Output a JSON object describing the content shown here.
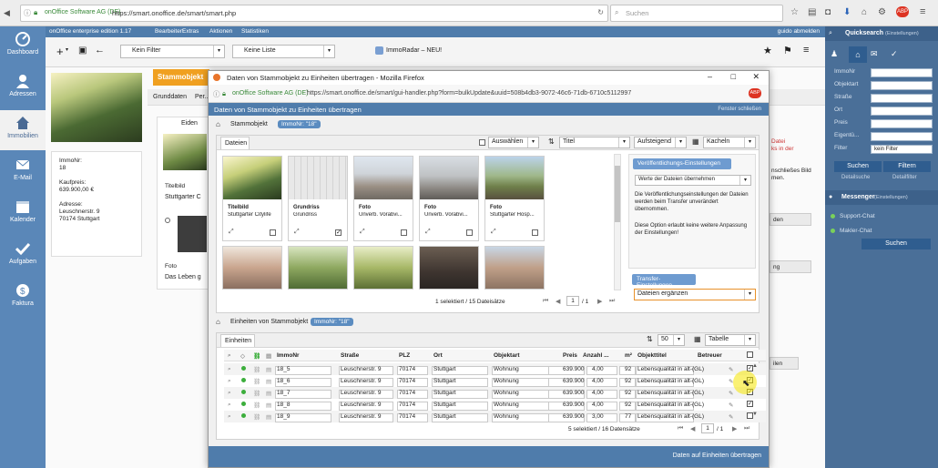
{
  "browser": {
    "url": "https://smart.onoffice.de/smart/smart.php",
    "site_identity": "onOffice Software AG (DE)",
    "search_placeholder": "Suchen"
  },
  "leftnav": [
    {
      "label": "Dashboard",
      "icon": "dashboard-icon"
    },
    {
      "label": "Adressen",
      "icon": "person-icon"
    },
    {
      "label": "Immobilien",
      "icon": "house-icon"
    },
    {
      "label": "E-Mail",
      "icon": "envelope-icon"
    },
    {
      "label": "Kalender",
      "icon": "calendar-icon"
    },
    {
      "label": "Aufgaben",
      "icon": "check-icon"
    },
    {
      "label": "Faktura",
      "icon": "money-icon"
    }
  ],
  "topmenu": {
    "edition": "onOffice enterprise edition 1.17",
    "items": [
      "Bearbeiten",
      "Extras",
      "Aktionen",
      "Statistiken"
    ],
    "logout": "guido abmelden"
  },
  "toolbar": {
    "filter": "Kein Filter",
    "list": "Keine Liste",
    "immoradar": "ImmoRadar – NEU!"
  },
  "background": {
    "tab_active": "Stammobjekt",
    "subtab": "Grunddaten",
    "subtab2": "Per...",
    "immonr_label": "ImmoNr:",
    "immonr": "18",
    "kaufpreis_label": "Kaufpreis:",
    "kaufpreis": "639.900,00 €",
    "adresse_label": "Adresse:",
    "adresse1": "Leuschnerstr. 9",
    "adresse2": "70174 Stuttgart",
    "files_tab": "Eiden",
    "titelbild_label": "Titelbild",
    "card_caption": "Stuttgarter C",
    "foto_label": "Foto",
    "foto_caption": "Das Leben g",
    "right_red_1": "Datei",
    "right_red_2": "ks in der",
    "right_text_1": "nschließes Bild",
    "right_text_2": "men.",
    "right_box_1": "den",
    "right_box_2": "ng",
    "right_box_3": "ilen"
  },
  "quicksearch": {
    "title": "Quicksearch",
    "subtitle": "(Einstellungen)",
    "fields": [
      "ImmoNr",
      "Objektart",
      "Straße",
      "Ort",
      "Preis",
      "Eigentü...",
      "Filter"
    ],
    "filter_value": "kein Filter",
    "btn_search": "Suchen",
    "btn_filter": "Filtern",
    "link_detail": "Detailsuche",
    "link_detailfilter": "Detailfilter",
    "messenger_title": "Messenger",
    "messenger_sub": "(Einstellungen)",
    "support_chat": "Support-Chat",
    "makler_chat": "Makler-Chat",
    "messenger_search": "Suchen"
  },
  "modal": {
    "window_title": "Daten von Stammobjekt zu Einheiten übertragen - Mozilla Firefox",
    "identity": "onOffice Software AG (DE)",
    "url": "https://smart.onoffice.de/smart/gui-handler.php?form=bulkUpdate&uuid=508b4db3-9072-46c6-71db-6710c5112997",
    "header": "Daten von Stammobjekt zu Einheiten übertragen",
    "close_window": "Fenster schließen",
    "stammobjekt_label": "Stammobjekt",
    "stammobjekt_badge": "ImmoNr: \"18\"",
    "dateien_tab": "Dateien",
    "auswaehlen": "Auswählen",
    "sort_field": "Titel",
    "sort_dir": "Aufsteigend",
    "view": "Kacheln",
    "cards": [
      {
        "type": "Titelbild",
        "title": "Stuttgarter Citylife",
        "checked": false
      },
      {
        "type": "Grundriss",
        "title": "Grundriss",
        "checked": true
      },
      {
        "type": "Foto",
        "title": "Unverb. Vorabvi...",
        "checked": false
      },
      {
        "type": "Foto",
        "title": "Unverb. Vorabvi...",
        "checked": false
      },
      {
        "type": "Foto",
        "title": "Stuttgarter Hosp...",
        "checked": false
      }
    ],
    "files_pagination": "1 selektiert / 15 Dateisätze",
    "page_current": "1",
    "page_total": "/ 1",
    "publish_title": "Veröffentlichungs-Einstellungen",
    "publish_select": "Werte der Dateien übernehmen",
    "publish_text1": "Die Veröffentlichungseinstellungen der Dateien werden beim Transfer unverändert übernommen.",
    "publish_text2": "Diese Option erlaubt keine weitere Anpassung der Einstellungen!",
    "transfer_title": "Transfer-Einstellungen",
    "transfer_select": "Dateien ergänzen",
    "einheiten_label": "Einheiten von Stammobjekt",
    "einheiten_badge": "ImmoNr: \"18\"",
    "einheiten_tab": "Einheiten",
    "per_page": "50",
    "table_view": "Tabelle",
    "columns": [
      "ImmoNr",
      "Straße",
      "PLZ",
      "Ort",
      "Objektart",
      "Preis",
      "Anzahl ...",
      "m²",
      "Objekttitel",
      "Betreuer"
    ],
    "rows": [
      {
        "immonr": "18_5",
        "strasse": "Leuschnerstr. 9",
        "plz": "70174",
        "ort": "Stuttgart",
        "objektart": "Wohnung",
        "preis": "639.900",
        "anzahl": "4,00",
        "m2": "92",
        "titel": "Lebensqualität in alt-(GL)",
        "checked": true
      },
      {
        "immonr": "18_6",
        "strasse": "Leuschnerstr. 9",
        "plz": "70174",
        "ort": "Stuttgart",
        "objektart": "Wohnung",
        "preis": "639.900",
        "anzahl": "4,00",
        "m2": "92",
        "titel": "Lebensqualität in alt-(GL)",
        "checked": true
      },
      {
        "immonr": "18_7",
        "strasse": "Leuschnerstr. 9",
        "plz": "70174",
        "ort": "Stuttgart",
        "objektart": "Wohnung",
        "preis": "639.900",
        "anzahl": "4,00",
        "m2": "92",
        "titel": "Lebensqualität in alt-(GL)",
        "checked": true
      },
      {
        "immonr": "18_8",
        "strasse": "Leuschnerstr. 9",
        "plz": "70174",
        "ort": "Stuttgart",
        "objektart": "Wohnung",
        "preis": "639.900",
        "anzahl": "4,00",
        "m2": "92",
        "titel": "Lebensqualität in alt-(GL)",
        "checked": true
      },
      {
        "immonr": "18_9",
        "strasse": "Leuschnerstr. 9",
        "plz": "70174",
        "ort": "Stuttgart",
        "objektart": "Wohnung",
        "preis": "639.900",
        "anzahl": "3,00",
        "m2": "77",
        "titel": "Lebensqualität in alt-(GL)",
        "checked": false
      }
    ],
    "units_pagination": "5 selektiert / 16 Datensätze",
    "submit": "Daten auf Einheiten übertragen"
  },
  "colors": {
    "nav_blue": "#5a87b8",
    "header_blue": "#4f7cab",
    "accent_orange": "#f0a020",
    "status_green": "#3cae3c",
    "highlight_yellow": "#f5e600"
  }
}
